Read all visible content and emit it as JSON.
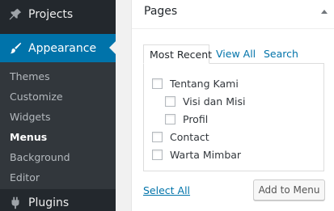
{
  "sidebar": {
    "projects_label": "Projects",
    "appearance_label": "Appearance",
    "submenu": [
      "Themes",
      "Customize",
      "Widgets",
      "Menus",
      "Background",
      "Editor"
    ],
    "current_submenu": "Menus",
    "plugins_label": "Plugins"
  },
  "postbox": {
    "title": "Pages",
    "tabs": {
      "most_recent": "Most Recent",
      "view_all": "View All",
      "search": "Search"
    },
    "active_tab": "Most Recent",
    "items": [
      {
        "label": "Tentang Kami",
        "level": 0,
        "checked": false
      },
      {
        "label": "Visi dan Misi",
        "level": 1,
        "checked": false
      },
      {
        "label": "Profil",
        "level": 1,
        "checked": false
      },
      {
        "label": "Contact",
        "level": 0,
        "checked": false
      },
      {
        "label": "Warta Mimbar",
        "level": 0,
        "checked": false
      }
    ],
    "select_all_label": "Select All",
    "add_button_label": "Add to Menu"
  },
  "colors": {
    "sidebar_bg": "#23282d",
    "submenu_bg": "#32373c",
    "accent": "#0073aa",
    "link": "#0073aa"
  },
  "icons": {
    "projects": "pin-icon",
    "appearance": "brush-icon",
    "plugins": "plug-icon",
    "postbox_toggle": "caret-up-icon"
  }
}
